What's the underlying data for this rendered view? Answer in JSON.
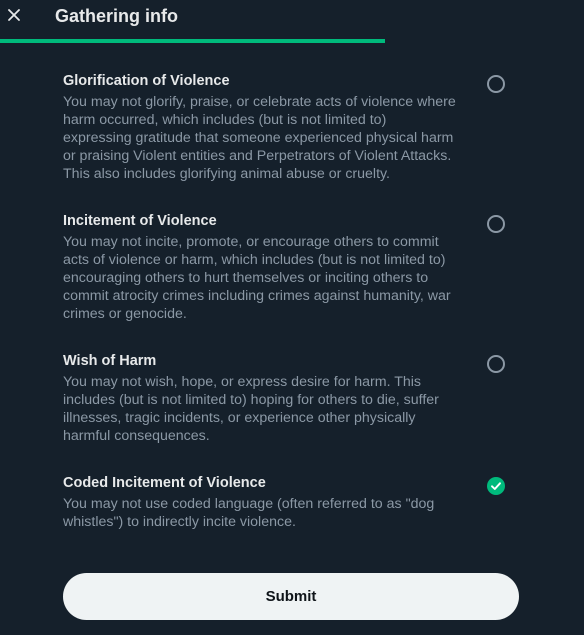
{
  "header": {
    "title": "Gathering info",
    "close_icon": "close-icon",
    "peek_text": "...",
    "progress_fraction": 0.66,
    "accent": "#00ba7c"
  },
  "options": [
    {
      "title": "Glorification of Violence",
      "lines": [
        "You may not glorify, praise, or celebrate acts of violence where",
        "harm occurred, which includes (but is not limited to)",
        "expressing gratitude that someone experienced physical harm",
        "or praising Violent entities and Perpetrators of Violent Attacks.",
        "This also includes glorifying animal abuse or cruelty."
      ],
      "selected": false
    },
    {
      "title": "Incitement of Violence",
      "lines": [
        "You may not incite, promote, or encourage others to commit",
        "acts of violence or harm, which includes (but is not limited to)",
        "encouraging others to hurt themselves or inciting others to",
        "commit atrocity crimes including crimes against humanity, war",
        "crimes or genocide."
      ],
      "selected": false
    },
    {
      "title": "Wish of Harm",
      "lines": [
        "You may not wish, hope, or express desire for harm. This",
        "includes (but is not limited to) hoping for others to die, suffer",
        "illnesses, tragic incidents, or experience other physically",
        "harmful consequences."
      ],
      "selected": false
    },
    {
      "title": "Coded Incitement of Violence",
      "lines": [
        "You may not use coded language (often referred to as \"dog",
        "whistles\") to indirectly incite violence."
      ],
      "selected": true
    }
  ],
  "footer": {
    "submit_label": "Submit"
  }
}
